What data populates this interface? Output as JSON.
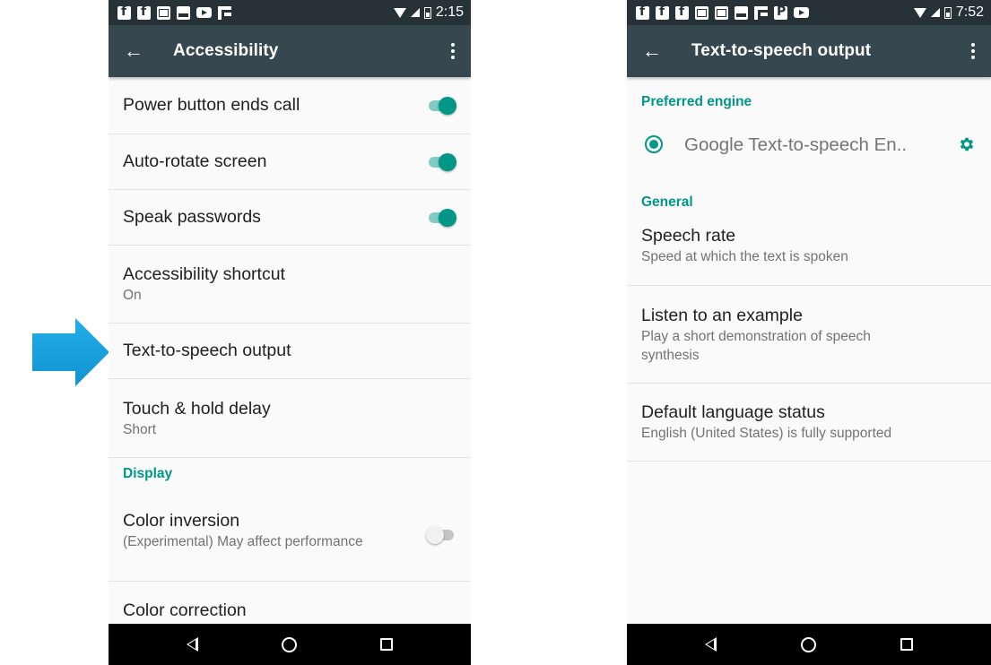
{
  "left_phone": {
    "status_time": "2:15",
    "app_title": "Accessibility",
    "items": [
      {
        "title": "Power button ends call",
        "toggle": true
      },
      {
        "title": "Auto-rotate screen",
        "toggle": true
      },
      {
        "title": "Speak passwords",
        "toggle": true
      },
      {
        "title": "Accessibility shortcut",
        "subtitle": "On"
      },
      {
        "title": "Text-to-speech output"
      },
      {
        "title": "Touch & hold delay",
        "subtitle": "Short"
      }
    ],
    "section_display": "Display",
    "color_inversion": {
      "title": "Color inversion",
      "subtitle": "(Experimental) May affect performance",
      "toggle": false
    },
    "color_correction": {
      "title": "Color correction"
    }
  },
  "right_phone": {
    "status_time": "7:52",
    "app_title": "Text-to-speech output",
    "section_preferred": "Preferred engine",
    "engine_name": "Google Text-to-speech En..",
    "section_general": "General",
    "items": [
      {
        "title": "Speech rate",
        "subtitle": "Speed at which the text is spoken"
      },
      {
        "title": "Listen to an example",
        "subtitle": "Play a short demonstration of speech synthesis"
      },
      {
        "title": "Default language status",
        "subtitle": "English (United States) is fully supported"
      }
    ]
  },
  "colors": {
    "accent": "#009688",
    "app_bar": "#37474f",
    "status_bar": "#263238",
    "arrow": "#1ba1e2"
  },
  "icons": {
    "back": "arrow-left-icon",
    "overflow": "more-vert-icon",
    "settings": "gear-icon",
    "pointer": "right-arrow-icon"
  }
}
